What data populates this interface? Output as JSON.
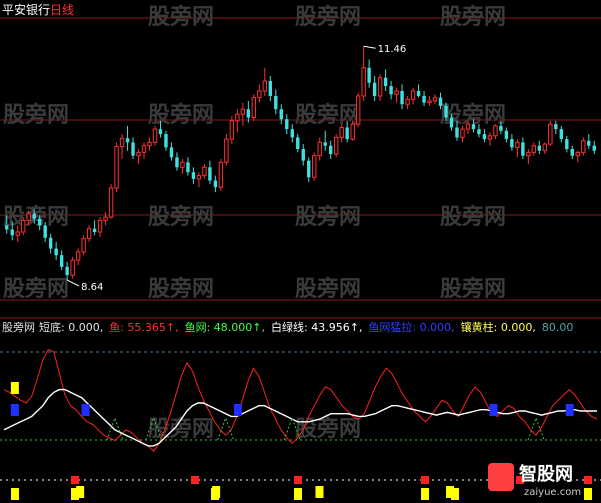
{
  "header": {
    "stock_name": "平安银行",
    "period": "日线",
    "name_color": "#ffffff",
    "period_color": "#ff3030"
  },
  "watermarks": [
    "股旁网",
    "智股网",
    "zaiyue.com"
  ],
  "indicator_bar": {
    "items": [
      {
        "label": "股旁网",
        "color": "#e0e0e0"
      },
      {
        "label": "短底: 0.000,",
        "color": "#e0e0e0"
      },
      {
        "label": "鱼: 55.365↑,",
        "color": "#ff3030"
      },
      {
        "label": "鱼网: 48.000↑,",
        "color": "#40ff40"
      },
      {
        "label": "白绿线: 43.956↑,",
        "color": "#ffffff"
      },
      {
        "label": "鱼网猛拉: 0.000,",
        "color": "#3040ff"
      },
      {
        "label": "镶黄柱: 0.000,",
        "color": "#ffff40"
      },
      {
        "label": "80.00",
        "color": "#60a0a0"
      }
    ]
  },
  "colors": {
    "background": "#000000",
    "up_candle": "#ff3030",
    "down_candle": "#40e0e0",
    "grid": "#8b1a1a",
    "fish_line": "#ff2020",
    "white_line": "#ffffff",
    "green_dotted": "#40c040",
    "blue_marker": "#2030ff",
    "yellow_marker": "#ffff00",
    "red_marker": "#ff2020"
  },
  "chart_data": [
    {
      "type": "candlestick",
      "title": "",
      "annotations": [
        {
          "label": "11.46",
          "type": "high_marker"
        },
        {
          "label": "8.64",
          "type": "low_marker"
        }
      ],
      "ylim": [
        8.4,
        11.8
      ],
      "candles": [
        [
          9.3,
          9.42,
          9.2,
          9.25
        ],
        [
          9.25,
          9.35,
          9.12,
          9.18
        ],
        [
          9.18,
          9.3,
          9.1,
          9.22
        ],
        [
          9.22,
          9.4,
          9.18,
          9.36
        ],
        [
          9.36,
          9.48,
          9.3,
          9.44
        ],
        [
          9.44,
          9.5,
          9.32,
          9.38
        ],
        [
          9.38,
          9.42,
          9.24,
          9.3
        ],
        [
          9.3,
          9.34,
          9.1,
          9.15
        ],
        [
          9.15,
          9.2,
          8.96,
          9.02
        ],
        [
          9.02,
          9.1,
          8.88,
          8.94
        ],
        [
          8.94,
          9.0,
          8.76,
          8.8
        ],
        [
          8.8,
          8.86,
          8.64,
          8.7
        ],
        [
          8.7,
          8.92,
          8.66,
          8.88
        ],
        [
          8.88,
          9.02,
          8.82,
          8.98
        ],
        [
          8.98,
          9.18,
          8.94,
          9.14
        ],
        [
          9.14,
          9.3,
          9.1,
          9.26
        ],
        [
          9.26,
          9.36,
          9.18,
          9.22
        ],
        [
          9.22,
          9.4,
          9.16,
          9.36
        ],
        [
          9.36,
          9.46,
          9.3,
          9.4
        ],
        [
          9.4,
          9.8,
          9.38,
          9.75
        ],
        [
          9.75,
          10.3,
          9.7,
          10.25
        ],
        [
          10.25,
          10.4,
          10.1,
          10.35
        ],
        [
          10.35,
          10.5,
          10.2,
          10.3
        ],
        [
          10.3,
          10.36,
          10.1,
          10.14
        ],
        [
          10.14,
          10.22,
          10.04,
          10.18
        ],
        [
          10.18,
          10.3,
          10.1,
          10.26
        ],
        [
          10.26,
          10.36,
          10.2,
          10.3
        ],
        [
          10.3,
          10.5,
          10.26,
          10.46
        ],
        [
          10.46,
          10.56,
          10.36,
          10.4
        ],
        [
          10.4,
          10.44,
          10.2,
          10.24
        ],
        [
          10.24,
          10.3,
          10.08,
          10.12
        ],
        [
          10.12,
          10.18,
          9.96,
          10.0
        ],
        [
          10.0,
          10.1,
          9.92,
          10.06
        ],
        [
          10.06,
          10.12,
          9.9,
          9.94
        ],
        [
          9.94,
          10.0,
          9.8,
          9.86
        ],
        [
          9.86,
          9.94,
          9.76,
          9.9
        ],
        [
          9.9,
          10.04,
          9.86,
          10.0
        ],
        [
          10.0,
          10.08,
          9.8,
          9.84
        ],
        [
          9.84,
          9.9,
          9.7,
          9.76
        ],
        [
          9.76,
          10.1,
          9.72,
          10.06
        ],
        [
          10.06,
          10.4,
          10.02,
          10.34
        ],
        [
          10.34,
          10.62,
          10.28,
          10.56
        ],
        [
          10.56,
          10.7,
          10.42,
          10.64
        ],
        [
          10.64,
          10.78,
          10.5,
          10.7
        ],
        [
          10.7,
          10.8,
          10.54,
          10.6
        ],
        [
          10.6,
          10.88,
          10.56,
          10.84
        ],
        [
          10.84,
          11.0,
          10.78,
          10.92
        ],
        [
          10.92,
          11.2,
          10.86,
          11.04
        ],
        [
          11.04,
          11.1,
          10.8,
          10.86
        ],
        [
          10.86,
          10.94,
          10.64,
          10.7
        ],
        [
          10.7,
          10.76,
          10.52,
          10.58
        ],
        [
          10.58,
          10.64,
          10.4,
          10.46
        ],
        [
          10.46,
          10.52,
          10.3,
          10.36
        ],
        [
          10.36,
          10.4,
          10.18,
          10.22
        ],
        [
          10.22,
          10.28,
          10.02,
          10.08
        ],
        [
          10.08,
          10.12,
          9.82,
          9.88
        ],
        [
          9.88,
          10.18,
          9.84,
          10.14
        ],
        [
          10.14,
          10.36,
          10.08,
          10.3
        ],
        [
          10.3,
          10.44,
          10.2,
          10.26
        ],
        [
          10.26,
          10.32,
          10.1,
          10.16
        ],
        [
          10.16,
          10.4,
          10.12,
          10.36
        ],
        [
          10.36,
          10.52,
          10.3,
          10.48
        ],
        [
          10.48,
          10.56,
          10.3,
          10.34
        ],
        [
          10.34,
          10.56,
          10.32,
          10.52
        ],
        [
          10.52,
          10.9,
          10.48,
          10.86
        ],
        [
          10.86,
          11.46,
          10.8,
          11.2
        ],
        [
          11.2,
          11.3,
          10.96,
          11.02
        ],
        [
          11.02,
          11.1,
          10.8,
          10.86
        ],
        [
          10.86,
          11.12,
          10.8,
          11.08
        ],
        [
          11.08,
          11.18,
          10.92,
          10.98
        ],
        [
          10.98,
          11.04,
          10.82,
          10.88
        ],
        [
          10.88,
          10.96,
          10.78,
          10.92
        ],
        [
          10.92,
          11.0,
          10.7,
          10.76
        ],
        [
          10.76,
          10.86,
          10.7,
          10.82
        ],
        [
          10.82,
          10.96,
          10.76,
          10.92
        ],
        [
          10.92,
          11.0,
          10.84,
          10.86
        ],
        [
          10.86,
          10.92,
          10.74,
          10.78
        ],
        [
          10.78,
          10.86,
          10.74,
          10.8
        ],
        [
          10.8,
          10.88,
          10.76,
          10.84
        ],
        [
          10.84,
          10.9,
          10.7,
          10.74
        ],
        [
          10.74,
          10.78,
          10.56,
          10.6
        ],
        [
          10.6,
          10.64,
          10.44,
          10.48
        ],
        [
          10.48,
          10.56,
          10.32,
          10.36
        ],
        [
          10.36,
          10.5,
          10.3,
          10.46
        ],
        [
          10.46,
          10.56,
          10.4,
          10.52
        ],
        [
          10.52,
          10.58,
          10.42,
          10.46
        ],
        [
          10.46,
          10.52,
          10.36,
          10.4
        ],
        [
          10.4,
          10.46,
          10.3,
          10.34
        ],
        [
          10.34,
          10.42,
          10.26,
          10.38
        ],
        [
          10.38,
          10.52,
          10.34,
          10.5
        ],
        [
          10.5,
          10.56,
          10.4,
          10.44
        ],
        [
          10.44,
          10.48,
          10.3,
          10.34
        ],
        [
          10.34,
          10.4,
          10.2,
          10.24
        ],
        [
          10.24,
          10.34,
          10.12,
          10.3
        ],
        [
          10.3,
          10.36,
          10.1,
          10.14
        ],
        [
          10.14,
          10.22,
          10.04,
          10.18
        ],
        [
          10.18,
          10.3,
          10.14,
          10.26
        ],
        [
          10.26,
          10.32,
          10.16,
          10.2
        ],
        [
          10.2,
          10.3,
          10.16,
          10.28
        ],
        [
          10.28,
          10.56,
          10.26,
          10.52
        ],
        [
          10.52,
          10.56,
          10.4,
          10.46
        ],
        [
          10.46,
          10.5,
          10.3,
          10.34
        ],
        [
          10.34,
          10.38,
          10.18,
          10.22
        ],
        [
          10.22,
          10.26,
          10.1,
          10.14
        ],
        [
          10.14,
          10.2,
          10.06,
          10.18
        ],
        [
          10.18,
          10.36,
          10.14,
          10.32
        ],
        [
          10.32,
          10.4,
          10.22,
          10.26
        ],
        [
          10.26,
          10.32,
          10.16,
          10.2
        ]
      ]
    },
    {
      "type": "line",
      "title": "",
      "ylim": [
        0,
        100
      ],
      "reference_levels": [
        80,
        48,
        20
      ],
      "series": [
        {
          "values": [
            60,
            58,
            55,
            52,
            50,
            55,
            68,
            82,
            90,
            88,
            72,
            56,
            48,
            45,
            40,
            36,
            34,
            30,
            26,
            24,
            22,
            26,
            30,
            28,
            24,
            20,
            18,
            14,
            20,
            30,
            42,
            56,
            70,
            80,
            74,
            62,
            52,
            44,
            36,
            30,
            26,
            30,
            40,
            52,
            66,
            76,
            70,
            58,
            46,
            38,
            30,
            24,
            20,
            24,
            30,
            40,
            48,
            56,
            62,
            60,
            54,
            48,
            44,
            40,
            38,
            42,
            52,
            62,
            70,
            76,
            72,
            64,
            56,
            50,
            44,
            40,
            36,
            40,
            46,
            52,
            50,
            44,
            40,
            48,
            56,
            62,
            58,
            50,
            42,
            40,
            44,
            48,
            46,
            40,
            36,
            30,
            26,
            32,
            40,
            48,
            52,
            56,
            60,
            56,
            50,
            44,
            40,
            38
          ]
        },
        {
          "values": [
            30,
            32,
            34,
            36,
            38,
            40,
            44,
            48,
            54,
            58,
            60,
            60,
            58,
            56,
            54,
            50,
            46,
            42,
            38,
            34,
            30,
            28,
            26,
            24,
            22,
            20,
            18,
            18,
            20,
            24,
            28,
            32,
            38,
            44,
            48,
            50,
            50,
            48,
            46,
            44,
            42,
            40,
            40,
            42,
            44,
            46,
            48,
            48,
            46,
            44,
            42,
            40,
            38,
            36,
            36,
            36,
            37,
            38,
            40,
            42,
            42,
            42,
            42,
            41,
            40,
            40,
            41,
            42,
            44,
            46,
            48,
            48,
            47,
            46,
            45,
            44,
            43,
            42,
            41,
            42,
            43,
            42,
            41,
            42,
            43,
            44,
            45,
            45,
            44,
            43,
            42,
            42,
            43,
            44,
            44,
            43,
            42,
            41,
            42,
            43,
            44,
            44,
            45,
            45,
            44,
            44,
            44,
            44
          ]
        }
      ],
      "markers": [
        {
          "kind": "yellow",
          "at": 2
        },
        {
          "kind": "blue",
          "at": 2
        },
        {
          "kind": "blue",
          "at": 15
        },
        {
          "kind": "blue",
          "at": 43
        },
        {
          "kind": "blue",
          "at": 90
        },
        {
          "kind": "blue",
          "at": 104
        },
        {
          "kind": "yellow",
          "at": 14
        },
        {
          "kind": "yellow",
          "at": 39
        },
        {
          "kind": "yellow",
          "at": 58
        },
        {
          "kind": "yellow",
          "at": 82
        },
        {
          "kind": "yellow",
          "at": 115
        }
      ]
    }
  ]
}
